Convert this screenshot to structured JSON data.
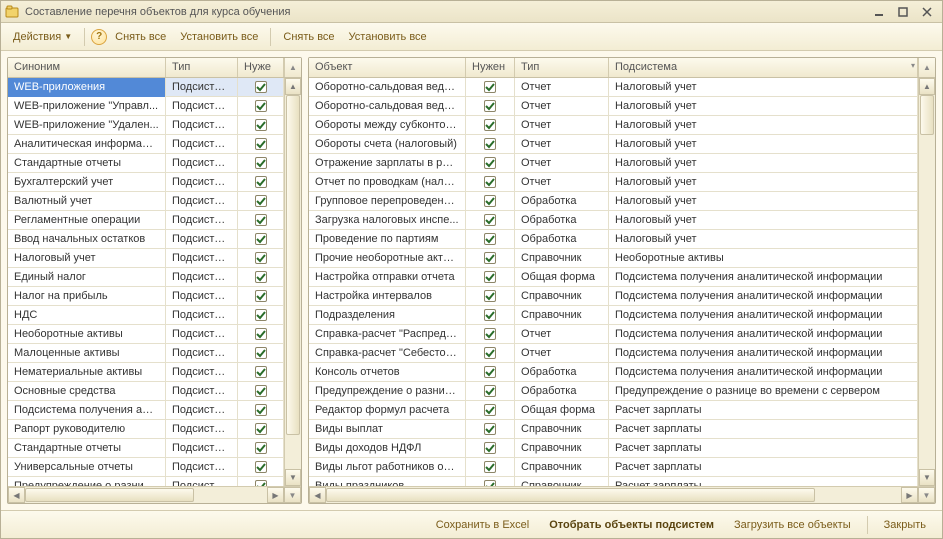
{
  "window": {
    "title": "Составление перечня объектов для курса обучения"
  },
  "toolbar": {
    "actions": "Действия",
    "uncheck_all_left": "Снять все",
    "check_all_left": "Установить все",
    "uncheck_all_right": "Снять все",
    "check_all_right": "Установить все"
  },
  "left": {
    "cols": {
      "synonym": "Синоним",
      "type": "Тип",
      "needed": "Нуже"
    },
    "rows": [
      {
        "s": "WEB-приложения",
        "t": "Подсистема",
        "c": true,
        "sel": true
      },
      {
        "s": "WEB-приложение \"Управл...",
        "t": "Подсистема",
        "c": true
      },
      {
        "s": "WEB-приложение \"Удален...",
        "t": "Подсистема",
        "c": true
      },
      {
        "s": "Аналитическая информация",
        "t": "Подсистема",
        "c": true
      },
      {
        "s": "Стандартные отчеты",
        "t": "Подсистема",
        "c": true
      },
      {
        "s": "Бухгалтерский учет",
        "t": "Подсистема",
        "c": true
      },
      {
        "s": "Валютный учет",
        "t": "Подсистема",
        "c": true
      },
      {
        "s": "Регламентные операции",
        "t": "Подсистема",
        "c": true
      },
      {
        "s": "Ввод начальных остатков",
        "t": "Подсистема",
        "c": true
      },
      {
        "s": "Налоговый учет",
        "t": "Подсистема",
        "c": true
      },
      {
        "s": "Единый налог",
        "t": "Подсистема",
        "c": true
      },
      {
        "s": "Налог на прибыль",
        "t": "Подсистема",
        "c": true
      },
      {
        "s": "НДС",
        "t": "Подсистема",
        "c": true
      },
      {
        "s": "Необоротные активы",
        "t": "Подсистема",
        "c": true
      },
      {
        "s": "Малоценные активы",
        "t": "Подсистема",
        "c": true
      },
      {
        "s": "Нематериальные активы",
        "t": "Подсистема",
        "c": true
      },
      {
        "s": "Основные средства",
        "t": "Подсистема",
        "c": true
      },
      {
        "s": "Подсистема получения ана...",
        "t": "Подсистема",
        "c": true
      },
      {
        "s": "Рапорт руководителю",
        "t": "Подсистема",
        "c": true
      },
      {
        "s": "Стандартные отчеты",
        "t": "Подсистема",
        "c": true
      },
      {
        "s": "Универсальные отчеты",
        "t": "Подсистема",
        "c": true
      },
      {
        "s": "Предупреждение о разниц...",
        "t": "Подсистема",
        "c": true
      }
    ]
  },
  "right": {
    "cols": {
      "object": "Объект",
      "needed": "Нужен",
      "type": "Тип",
      "subsystem": "Подсистема"
    },
    "rows": [
      {
        "o": "Оборотно-сальдовая ведо...",
        "c": true,
        "t": "Отчет",
        "s": "Налоговый учет"
      },
      {
        "o": "Оборотно-сальдовая ведо...",
        "c": true,
        "t": "Отчет",
        "s": "Налоговый учет"
      },
      {
        "o": "Обороты между субконто (...",
        "c": true,
        "t": "Отчет",
        "s": "Налоговый учет"
      },
      {
        "o": "Обороты счета (налоговый)",
        "c": true,
        "t": "Отчет",
        "s": "Налоговый учет"
      },
      {
        "o": "Отражение зарплаты в рег...",
        "c": true,
        "t": "Отчет",
        "s": "Налоговый учет"
      },
      {
        "o": "Отчет по проводкам (налог...",
        "c": true,
        "t": "Отчет",
        "s": "Налоговый учет"
      },
      {
        "o": "Групповое перепроведение...",
        "c": true,
        "t": "Обработка",
        "s": "Налоговый учет"
      },
      {
        "o": "Загрузка налоговых инспе...",
        "c": true,
        "t": "Обработка",
        "s": "Налоговый учет"
      },
      {
        "o": "Проведение по партиям",
        "c": true,
        "t": "Обработка",
        "s": "Налоговый учет"
      },
      {
        "o": "Прочие необоротные активы",
        "c": true,
        "t": "Справочник",
        "s": "Необоротные активы"
      },
      {
        "o": "Настройка отправки отчета",
        "c": true,
        "t": "Общая форма",
        "s": "Подсистема получения аналитической информации"
      },
      {
        "o": "Настройка интервалов",
        "c": true,
        "t": "Справочник",
        "s": "Подсистема получения аналитической информации"
      },
      {
        "o": "Подразделения",
        "c": true,
        "t": "Справочник",
        "s": "Подсистема получения аналитической информации"
      },
      {
        "o": "Справка-расчет \"Распреде...",
        "c": true,
        "t": "Отчет",
        "s": "Подсистема получения аналитической информации"
      },
      {
        "o": "Справка-расчет \"Себестои...",
        "c": true,
        "t": "Отчет",
        "s": "Подсистема получения аналитической информации"
      },
      {
        "o": "Консоль отчетов",
        "c": true,
        "t": "Обработка",
        "s": "Подсистема получения аналитической информации"
      },
      {
        "o": "Предупреждение о разниц...",
        "c": true,
        "t": "Обработка",
        "s": "Предупреждение о разнице во времени с сервером"
      },
      {
        "o": "Редактор формул расчета",
        "c": true,
        "t": "Общая форма",
        "s": "Расчет зарплаты"
      },
      {
        "o": "Виды выплат",
        "c": true,
        "t": "Справочник",
        "s": "Расчет зарплаты"
      },
      {
        "o": "Виды доходов НДФЛ",
        "c": true,
        "t": "Справочник",
        "s": "Расчет зарплаты"
      },
      {
        "o": "Виды льгот работников орг...",
        "c": true,
        "t": "Справочник",
        "s": "Расчет зарплаты"
      },
      {
        "o": "Виды праздников",
        "c": true,
        "t": "Справочник",
        "s": "Расчет зарплаты"
      }
    ]
  },
  "bottom": {
    "save_excel": "Сохранить в Excel",
    "select_objects": "Отобрать объекты подсистем",
    "load_all": "Загрузить все объекты",
    "close": "Закрыть"
  }
}
